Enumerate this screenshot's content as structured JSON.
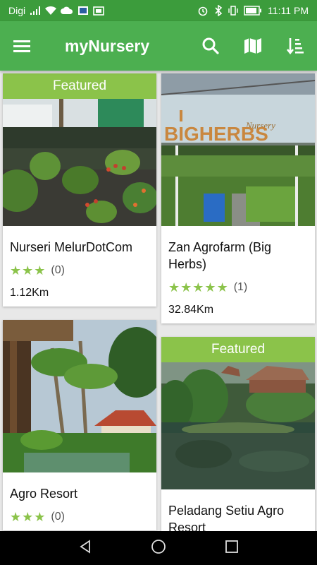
{
  "status_bar": {
    "carrier": "Digi",
    "time": "11:11 PM",
    "icons": [
      "signal-icon",
      "wifi-icon",
      "cloud-icon",
      "notification-icon",
      "alarm-icon",
      "bluetooth-icon",
      "battery-icon"
    ]
  },
  "app_bar": {
    "title": "myNursery",
    "menu_icon": "menu-icon",
    "search_icon": "search-icon",
    "map_icon": "map-icon",
    "sort_icon": "sort-icon"
  },
  "cards": [
    {
      "featured": "Featured",
      "title": "Nurseri MelurDotCom",
      "rating": 3,
      "rating_count": "(0)",
      "distance": "1.12Km"
    },
    {
      "featured": "",
      "title": "Zan Agrofarm (Big Herbs)",
      "image_text": "BIGHERBS",
      "image_subtext": "Nursery",
      "rating": 5,
      "rating_count": "(1)",
      "distance": "32.84Km"
    },
    {
      "featured": "",
      "title": "Agro Resort",
      "rating": 3,
      "rating_count": "(0)",
      "distance": ""
    },
    {
      "featured": "Featured",
      "title": "Peladang Setiu Agro Resort",
      "rating": 0,
      "rating_count": "",
      "distance": ""
    }
  ],
  "colors": {
    "status_bar": "#3c9c3c",
    "app_bar": "#4caf50",
    "featured": "#8bc34a",
    "star": "#8bc34a"
  },
  "nav_bar": {
    "icons": [
      "back-icon",
      "home-icon",
      "recents-icon"
    ]
  }
}
